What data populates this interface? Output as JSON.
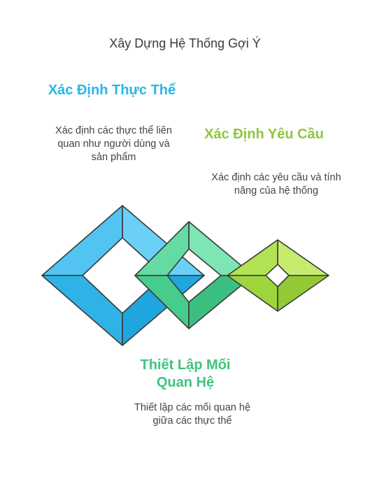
{
  "title": "Xây Dựng Hệ Thống Gợi Ý",
  "steps": [
    {
      "heading": "Xác Định Thực Thể",
      "description": "Xác định các thực thể liên quan như người dùng và sản phẩm",
      "color": "#29b6e8"
    },
    {
      "heading": "Xác Định Yêu Cầu",
      "description": "Xác định các yêu cầu và tính năng của hệ thống",
      "color": "#8dc63f"
    },
    {
      "heading": "Thiết Lập Mối Quan Hệ",
      "description": "Thiết lập các mối quan hệ giữa các thực thể",
      "color": "#3fc47e"
    }
  ]
}
